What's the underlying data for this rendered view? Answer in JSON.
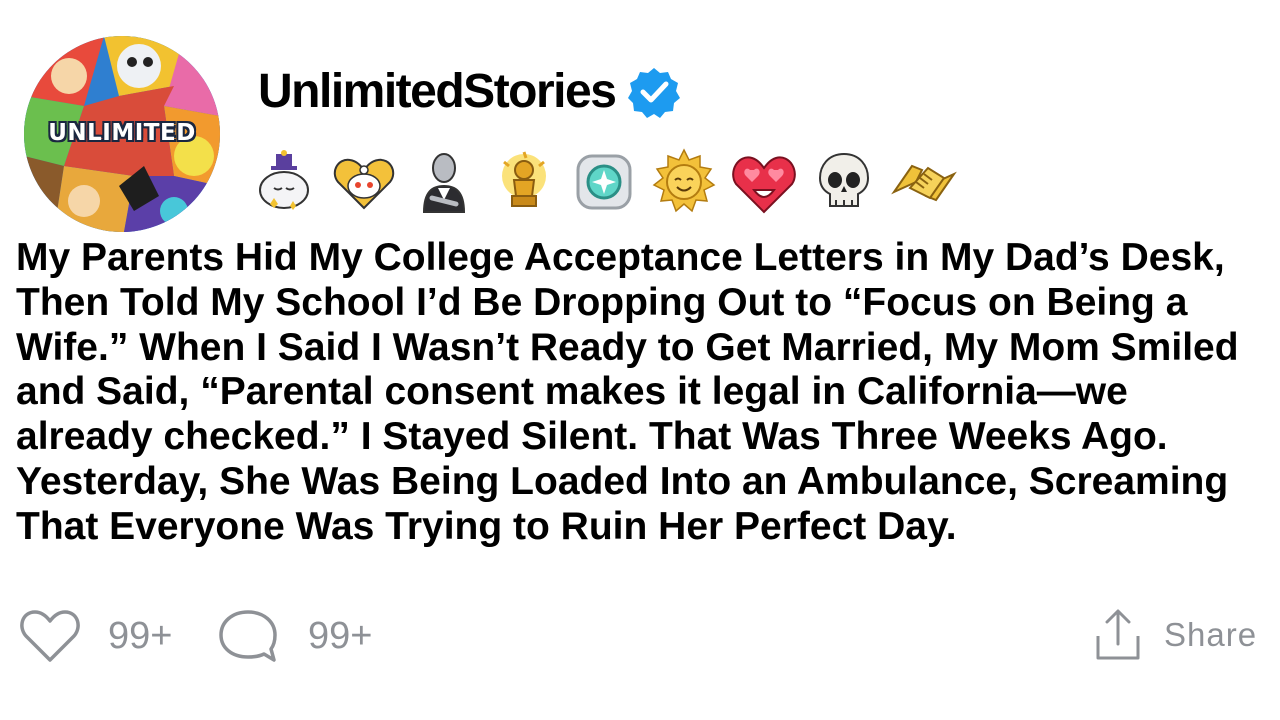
{
  "post": {
    "author": {
      "username": "UnlimitedStories",
      "avatar_text": "UNLIMITED",
      "verified": true,
      "verified_icon": "verified-badge-icon",
      "verified_color": "#1d9bf0"
    },
    "badges": [
      {
        "icon": "sleeping-snoo-award-icon"
      },
      {
        "icon": "heart-snoo-award-icon"
      },
      {
        "icon": "bald-statue-award-icon"
      },
      {
        "icon": "gold-trophy-award-icon"
      },
      {
        "icon": "silver-gem-award-icon"
      },
      {
        "icon": "smiling-sun-award-icon"
      },
      {
        "icon": "heart-eyes-award-icon"
      },
      {
        "icon": "skull-award-icon"
      },
      {
        "icon": "handshake-award-icon"
      }
    ],
    "title": "My Parents Hid My College Acceptance Letters in My Dad’s Desk, Then Told My School I’d Be Dropping Out to “Focus on Being a Wife.” When I Said I Wasn’t Ready to Get Married, My Mom Smiled and Said, “Parental consent makes it legal in California—we already checked.” I Stayed Silent. That Was Three Weeks Ago. Yesterday, She Was Being Loaded Into an Ambulance, Screaming That Everyone Was Trying to Ruin Her Perfect Day.",
    "actions": {
      "like_count": "99+",
      "comment_count": "99+",
      "share_label": "Share"
    },
    "colors": {
      "action_gray": "#8e9196",
      "text": "#000000",
      "background": "#ffffff"
    }
  }
}
